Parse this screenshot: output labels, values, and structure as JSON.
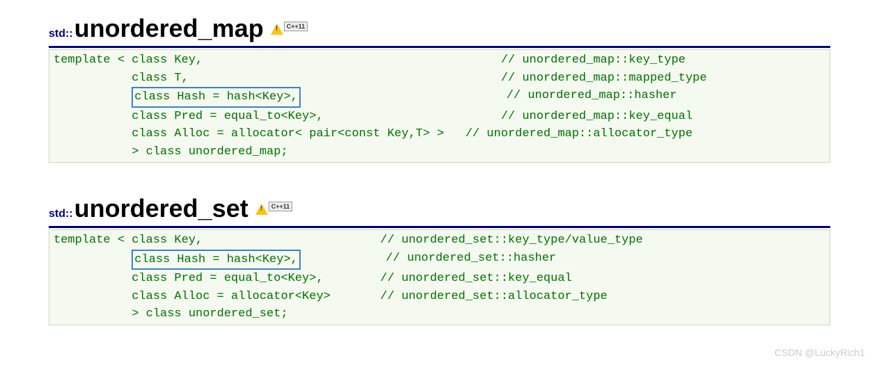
{
  "map": {
    "ns": "std::",
    "title": "unordered_map",
    "cpp": "C++11",
    "lines": [
      {
        "pre": "template",
        "open": " < ",
        "param": "class Key,",
        "hl": false,
        "pad": "                                          ",
        "comment": "// unordered_map::key_type"
      },
      {
        "pre": "        ",
        "open": "   ",
        "param": "class T,",
        "hl": false,
        "pad": "                                            ",
        "comment": "// unordered_map::mapped_type"
      },
      {
        "pre": "        ",
        "open": "   ",
        "param": "class Hash = hash<Key>,",
        "hl": true,
        "pad": "                             ",
        "comment": "// unordered_map::hasher"
      },
      {
        "pre": "        ",
        "open": "   ",
        "param": "class Pred = equal_to<Key>,",
        "hl": false,
        "pad": "                         ",
        "comment": "// unordered_map::key_equal"
      },
      {
        "pre": "        ",
        "open": "   ",
        "param": "class Alloc = allocator< pair<const Key,T> >",
        "hl": false,
        "pad": "   ",
        "comment": "// unordered_map::allocator_type"
      },
      {
        "pre": "        ",
        "open": "   ",
        "param": "> class unordered_map;",
        "hl": false,
        "pad": "",
        "comment": ""
      }
    ]
  },
  "set": {
    "ns": "std::",
    "title": "unordered_set",
    "cpp": "C++11",
    "lines": [
      {
        "pre": "template",
        "open": " < ",
        "param": "class Key,",
        "hl": false,
        "pad": "                         ",
        "comment": "// unordered_set::key_type/value_type"
      },
      {
        "pre": "        ",
        "open": "   ",
        "param": "class Hash = hash<Key>,",
        "hl": true,
        "pad": "            ",
        "comment": "// unordered_set::hasher"
      },
      {
        "pre": "        ",
        "open": "   ",
        "param": "class Pred = equal_to<Key>,",
        "hl": false,
        "pad": "        ",
        "comment": "// unordered_set::key_equal"
      },
      {
        "pre": "        ",
        "open": "   ",
        "param": "class Alloc = allocator<Key>",
        "hl": false,
        "pad": "       ",
        "comment": "// unordered_set::allocator_type"
      },
      {
        "pre": "        ",
        "open": "   ",
        "param": "> class unordered_set;",
        "hl": false,
        "pad": "",
        "comment": ""
      }
    ]
  },
  "watermark": "CSDN @LuckyRich1"
}
